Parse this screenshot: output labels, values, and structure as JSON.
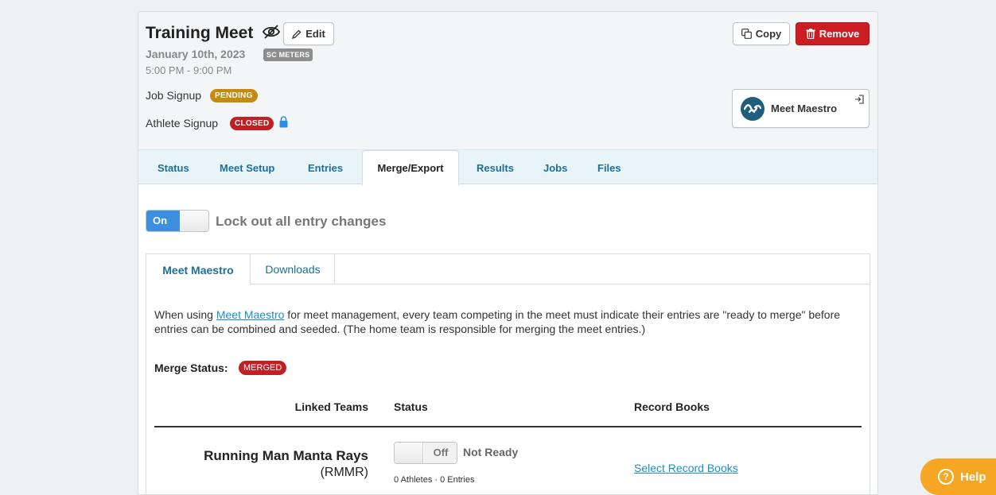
{
  "meet": {
    "title": "Training Meet",
    "date": "January 10th, 2023",
    "course": "SC METERS",
    "time": "5:00 PM - 9:00 PM"
  },
  "actions": {
    "edit_label": "Edit",
    "copy_label": "Copy",
    "remove_label": "Remove",
    "meet_maestro_label": "Meet Maestro"
  },
  "signup": {
    "job_label": "Job Signup",
    "job_status": "PENDING",
    "athlete_label": "Athlete Signup",
    "athlete_status": "CLOSED"
  },
  "tabs": [
    {
      "label": "Status"
    },
    {
      "label": "Meet Setup"
    },
    {
      "label": "Entries"
    },
    {
      "label": "Merge/Export"
    },
    {
      "label": "Results"
    },
    {
      "label": "Jobs"
    },
    {
      "label": "Files"
    }
  ],
  "lockout": {
    "toggle_label": "On",
    "text": "Lock out all entry changes"
  },
  "subtabs": [
    {
      "label": "Meet Maestro"
    },
    {
      "label": "Downloads"
    }
  ],
  "description": {
    "before": "When using ",
    "link": "Meet Maestro",
    "after": " for meet management, every team competing in the meet must indicate their entries are \"ready to merge\" before entries can be combined and seeded. (The home team is responsible for merging the meet entries.)"
  },
  "merge": {
    "label": "Merge Status:",
    "status": "MERGED"
  },
  "table": {
    "headers": {
      "teams": "Linked Teams",
      "status": "Status",
      "record_books": "Record Books"
    },
    "rows": [
      {
        "team": "Running Man Manta Rays",
        "code": "(RMMR)",
        "toggle": "Off",
        "state": "Not Ready",
        "counts": "0 Athletes · 0 Entries",
        "record_books_link": "Select Record Books"
      }
    ]
  },
  "help": {
    "label": "Help"
  },
  "colors": {
    "accent": "#1f6f9a",
    "danger": "#cc1d23",
    "pending": "#c58a10",
    "toggle_on": "#3d8fe0",
    "help": "#f5a623"
  }
}
